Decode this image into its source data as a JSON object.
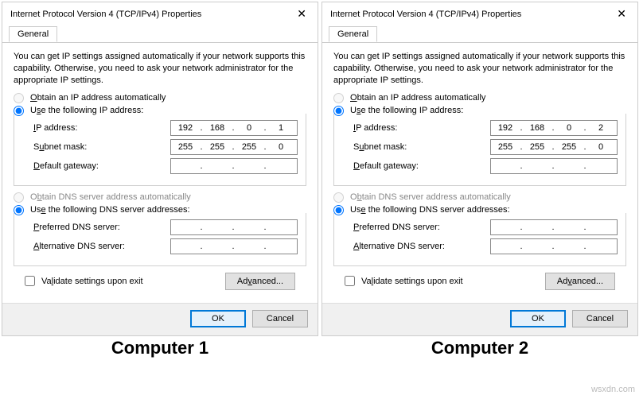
{
  "dialogs": [
    {
      "title": "Internet Protocol Version 4 (TCP/IPv4) Properties",
      "tab": "General",
      "desc": "You can get IP settings assigned automatically if your network supports this capability. Otherwise, you need to ask your network administrator for the appropriate IP settings.",
      "obtain_ip_auto": "Obtain an IP address automatically",
      "use_ip": "Use the following IP address:",
      "ip_label": "IP address:",
      "subnet_label": "Subnet mask:",
      "gateway_label": "Default gateway:",
      "ip_value": [
        "192",
        "168",
        "0",
        "1"
      ],
      "subnet_value": [
        "255",
        "255",
        "255",
        "0"
      ],
      "gateway_value": [
        "",
        "",
        "",
        ""
      ],
      "obtain_dns_auto": "Obtain DNS server address automatically",
      "use_dns": "Use the following DNS server addresses:",
      "pref_dns_label": "Preferred DNS server:",
      "alt_dns_label": "Alternative DNS server:",
      "pref_dns_value": [
        "",
        "",
        "",
        ""
      ],
      "alt_dns_value": [
        "",
        "",
        "",
        ""
      ],
      "validate": "Validate settings upon exit",
      "advanced": "Advanced...",
      "ok": "OK",
      "cancel": "Cancel",
      "caption": "Computer 1"
    },
    {
      "title": "Internet Protocol Version 4 (TCP/IPv4) Properties",
      "tab": "General",
      "desc": "You can get IP settings assigned automatically if your network supports this capability. Otherwise, you need to ask your network administrator for the appropriate IP settings.",
      "obtain_ip_auto": "Obtain an IP address automatically",
      "use_ip": "Use the following IP address:",
      "ip_label": "IP address:",
      "subnet_label": "Subnet mask:",
      "gateway_label": "Default gateway:",
      "ip_value": [
        "192",
        "168",
        "0",
        "2"
      ],
      "subnet_value": [
        "255",
        "255",
        "255",
        "0"
      ],
      "gateway_value": [
        "",
        "",
        "",
        ""
      ],
      "obtain_dns_auto": "Obtain DNS server address automatically",
      "use_dns": "Use the following DNS server addresses:",
      "pref_dns_label": "Preferred DNS server:",
      "alt_dns_label": "Alternative DNS server:",
      "pref_dns_value": [
        "",
        "",
        "",
        ""
      ],
      "alt_dns_value": [
        "",
        "",
        "",
        ""
      ],
      "validate": "Validate settings upon exit",
      "advanced": "Advanced...",
      "ok": "OK",
      "cancel": "Cancel",
      "caption": "Computer 2"
    }
  ],
  "watermark": "wsxdn.com"
}
